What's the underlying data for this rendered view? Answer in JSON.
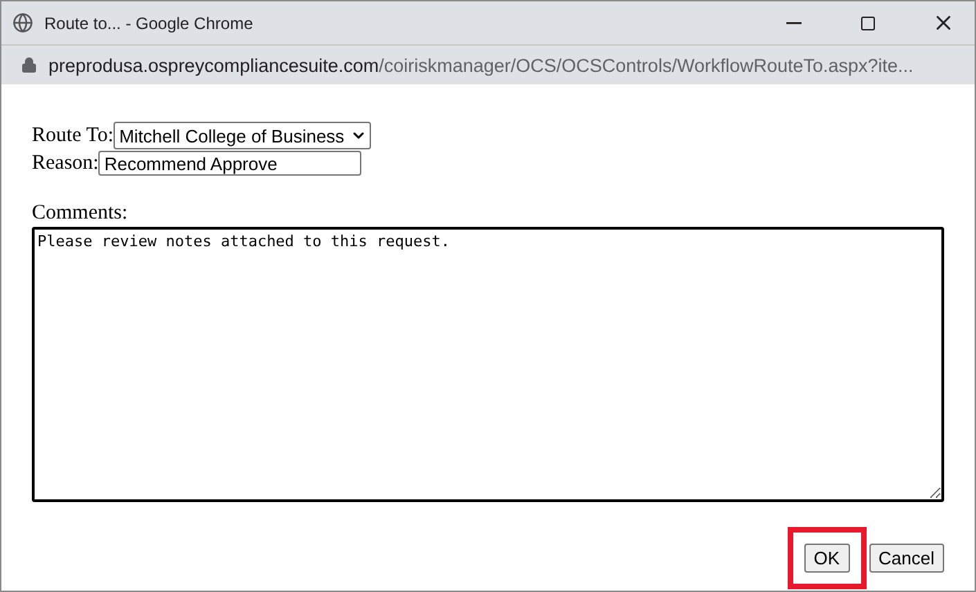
{
  "window": {
    "title": "Route to... - Google Chrome"
  },
  "address_bar": {
    "domain": "preprodusa.ospreycompliancesuite.com",
    "path": "/coiriskmanager/OCS/OCSControls/WorkflowRouteTo.aspx?ite..."
  },
  "form": {
    "route_to": {
      "label": "Route To:",
      "value": "Mitchell College of Business"
    },
    "reason": {
      "label": "Reason:",
      "value": "Recommend Approve"
    },
    "comments": {
      "label": "Comments:",
      "value": "Please review notes attached to this request."
    }
  },
  "buttons": [
    {
      "label": "OK",
      "highlighted": true
    },
    {
      "label": "Cancel",
      "highlighted": false
    }
  ]
}
